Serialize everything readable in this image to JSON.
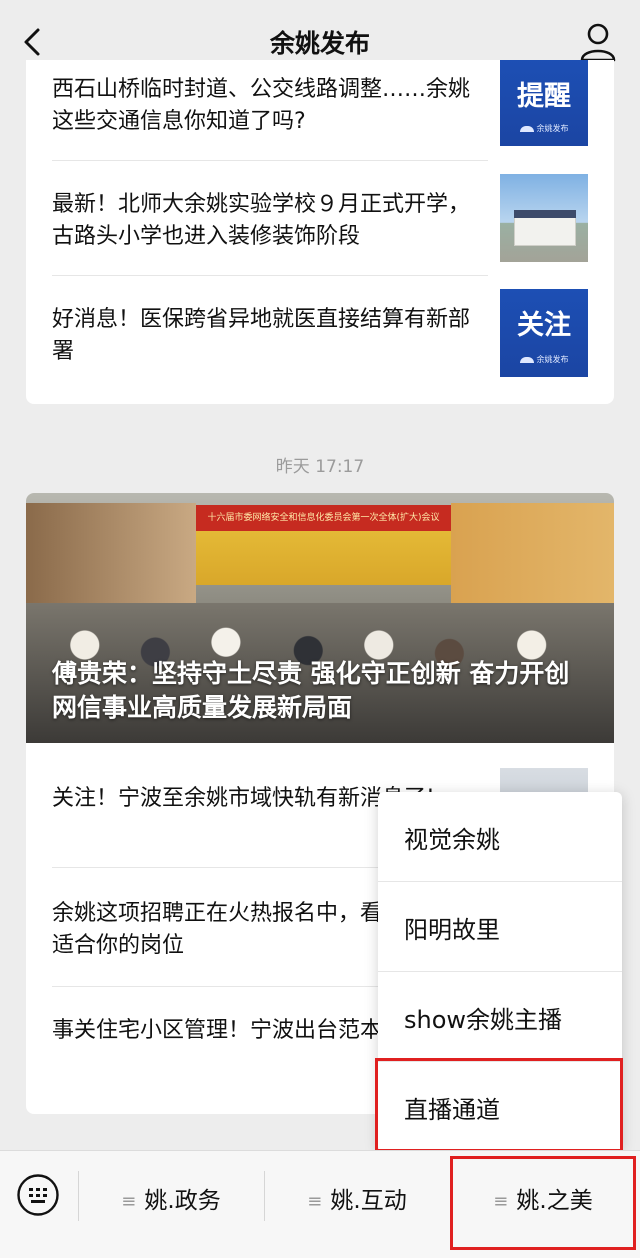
{
  "header": {
    "title": "余姚发布"
  },
  "card1": {
    "articles": [
      {
        "title": "西石山桥临时封道、公交线路调整……余姚这些交通信息你知道了吗?",
        "thumb_text": "提醒",
        "thumb_logo": "余姚发布"
      },
      {
        "title": "最新！北师大余姚实验学校９月正式开学，古路头小学也进入装修装饰阶段"
      },
      {
        "title": "好消息！医保跨省异地就医直接结算有新部署",
        "thumb_text": "关注",
        "thumb_logo": "余姚发布"
      }
    ]
  },
  "timestamp": "昨天 17:17",
  "card2": {
    "cover": {
      "banner_text": "十六届市委网络安全和信息化委员会第一次全体(扩大)会议",
      "title": "傅贵荣：坚持守土尽责 强化守正创新 奋力开创网信事业高质量发展新局面"
    },
    "articles": [
      {
        "title": "关注！宁波至余姚市域快轨有新消息了!"
      },
      {
        "title": "余姚这项招聘正在火热报名中，看看有没有适合你的岗位"
      },
      {
        "title": "事关住宅小区管理！宁波出台范本文本"
      }
    ]
  },
  "popup_menu": {
    "items": [
      {
        "label": "视觉余姚"
      },
      {
        "label": "阳明故里"
      },
      {
        "label": "show余姚主播"
      },
      {
        "label": "直播通道"
      }
    ]
  },
  "menubar": {
    "tabs": [
      {
        "label": "姚.政务"
      },
      {
        "label": "姚.互动"
      },
      {
        "label": "姚.之美"
      }
    ],
    "hamburger_glyph": "≡"
  },
  "colors": {
    "background": "#ededed",
    "highlight": "#e02020",
    "thumb_blue": "#1d4fb4"
  }
}
